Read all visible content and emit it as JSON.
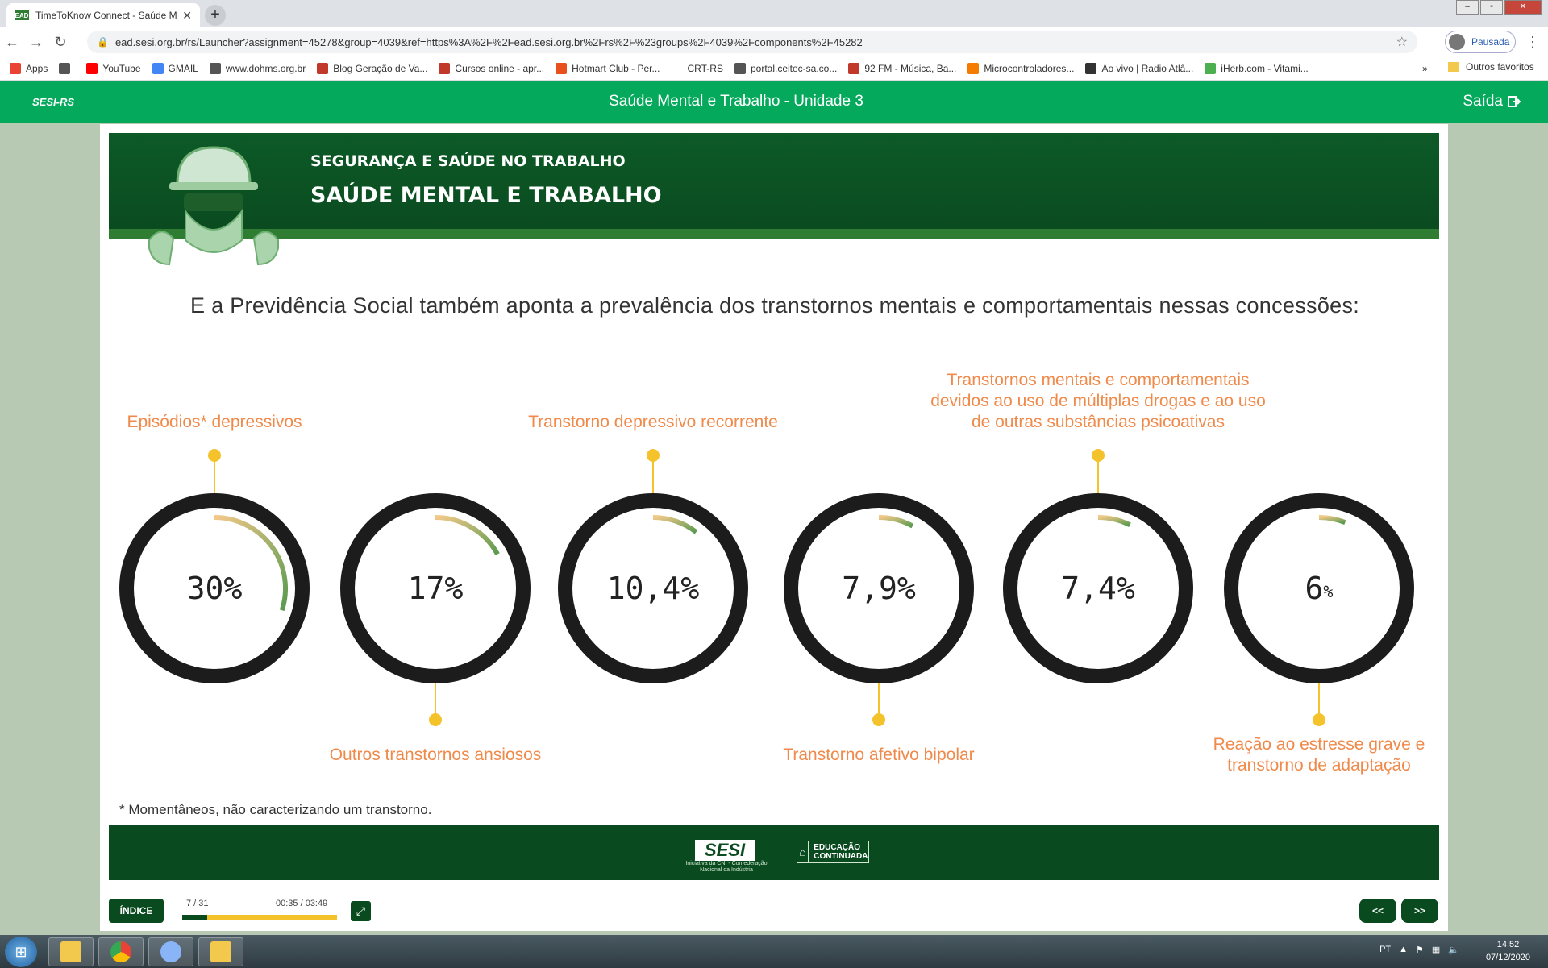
{
  "browser": {
    "tab_title": "TimeToKnow Connect - Saúde M",
    "tab_icon_text": "EAD",
    "url": "ead.sesi.org.br/rs/Launcher?assignment=45278&group=4039&ref=https%3A%2F%2Fead.sesi.org.br%2Frs%2F%23groups%2F4039%2Fcomponents%2F45282",
    "profile_label": "Pausada",
    "bookmarks": [
      {
        "label": "Apps",
        "color": "#ea4335"
      },
      {
        "label": "",
        "color": "#555555"
      },
      {
        "label": "YouTube",
        "color": "#ff0000"
      },
      {
        "label": "GMAIL",
        "color": "#4285f4"
      },
      {
        "label": "www.dohms.org.br",
        "color": "#555555"
      },
      {
        "label": "Blog Geração de Va...",
        "color": "#c0392b"
      },
      {
        "label": "Cursos online - apr...",
        "color": "#c0392b"
      },
      {
        "label": "Hotmart Club - Per...",
        "color": "#e8501c"
      },
      {
        "label": "CRT-RS",
        "color": "#ffffff"
      },
      {
        "label": "portal.ceitec-sa.co...",
        "color": "#555555"
      },
      {
        "label": "92 FM - Música, Ba...",
        "color": "#c0392b"
      },
      {
        "label": "Microcontroladores...",
        "color": "#f57c00"
      },
      {
        "label": "Ao vivo | Radio Atlâ...",
        "color": "#333333"
      },
      {
        "label": "iHerb.com - Vitami...",
        "color": "#4caf50"
      }
    ],
    "more_bookmarks": "»",
    "other_bookmarks": "Outros favoritos"
  },
  "appbar": {
    "logo": "SESI-RS",
    "title": "Saúde Mental e Trabalho - Unidade 3",
    "exit_label": "Saída"
  },
  "banner": {
    "kicker": "SEGURANÇA E SAÚDE NO TRABALHO",
    "title": "SAÚDE MENTAL E TRABALHO"
  },
  "lead_text": "E a Previdência Social também aponta a prevalência dos transtornos mentais e comportamentais nessas concessões:",
  "stats": [
    {
      "number": "30",
      "unit": "%",
      "fraction": 0.3,
      "label": "Episódios* depressivos",
      "label_position": "top"
    },
    {
      "number": "17",
      "unit": "%",
      "fraction": 0.17,
      "label": "Outros transtornos ansiosos",
      "label_position": "bottom"
    },
    {
      "number": "10,4",
      "unit": "%",
      "fraction": 0.104,
      "label": "Transtorno depressivo recorrente",
      "label_position": "top"
    },
    {
      "number": "7,9",
      "unit": "%",
      "fraction": 0.079,
      "label": "Transtorno afetivo bipolar",
      "label_position": "bottom"
    },
    {
      "number": "7,4",
      "unit": "%",
      "fraction": 0.074,
      "label": "Transtornos mentais e comportamentais devidos ao uso de múltiplas drogas e ao uso de outras substâncias psicoativas",
      "label_position": "top"
    },
    {
      "number": "6",
      "unit": "%",
      "fraction": 0.06,
      "label": "Reação ao estresse grave e transtorno de adaptação",
      "label_position": "bottom"
    }
  ],
  "footnote": "* Momentâneos, não caracterizando um transtorno.",
  "footer": {
    "sesi": "SESI",
    "sesi_sub": "Iniciativa da CNI - Confederação Nacional da Indústria",
    "educ": "EDUCAÇÃO CONTINUADA"
  },
  "player": {
    "index_label": "ÍNDICE",
    "page": "7 / 31",
    "time": "00:35 / 03:49",
    "progress": 0.16,
    "prev_label": "<<",
    "next_label": ">>"
  },
  "taskbar": {
    "lang": "PT",
    "time": "14:52",
    "date": "07/12/2020"
  },
  "colors": {
    "brand_green": "#05a95c",
    "dark_green": "#0a4a1f",
    "accent_orange": "#f08a4b",
    "accent_yellow": "#f4c22b"
  }
}
